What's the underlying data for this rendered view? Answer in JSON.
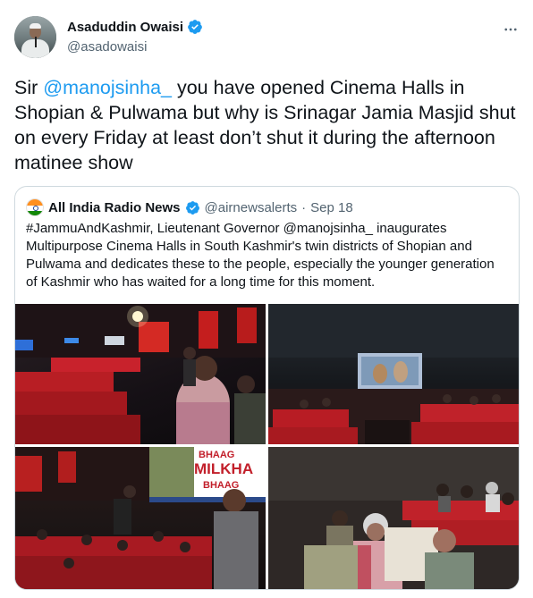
{
  "author": {
    "display_name": "Asaduddin Owaisi",
    "handle": "@asadowaisi",
    "verified": true
  },
  "tweet": {
    "text_prefix": "Sir ",
    "mention": "@manojsinha_",
    "text_suffix": " you have opened Cinema Halls in Shopian & Pulwama but why is Srinagar Jamia  Masjid shut on  every Friday at least don’t shut it during the afternoon matinee  show"
  },
  "quoted_tweet": {
    "display_name": "All India Radio News",
    "handle": "@airnewsalerts",
    "separator": "·",
    "date": "Sep 18",
    "text": "#JammuAndKashmir, Lieutenant Governor @manojsinha_ inaugurates Multipurpose Cinema Halls in South Kashmir's twin districts of Shopian and Pulwama and dedicates these to the people, especially the younger generation of Kashmir who has waited for a long time for this moment.",
    "poster_text": [
      "BHAAG",
      "MILKHA",
      "BHAAG"
    ]
  },
  "colors": {
    "accent": "#1d9bf0",
    "text_primary": "#0f1419",
    "text_secondary": "#536471",
    "border": "#cfd9de",
    "seat_red": "#c8222c"
  },
  "icons": {
    "verified": "verified-badge-icon",
    "more": "more-horizontal-icon"
  }
}
